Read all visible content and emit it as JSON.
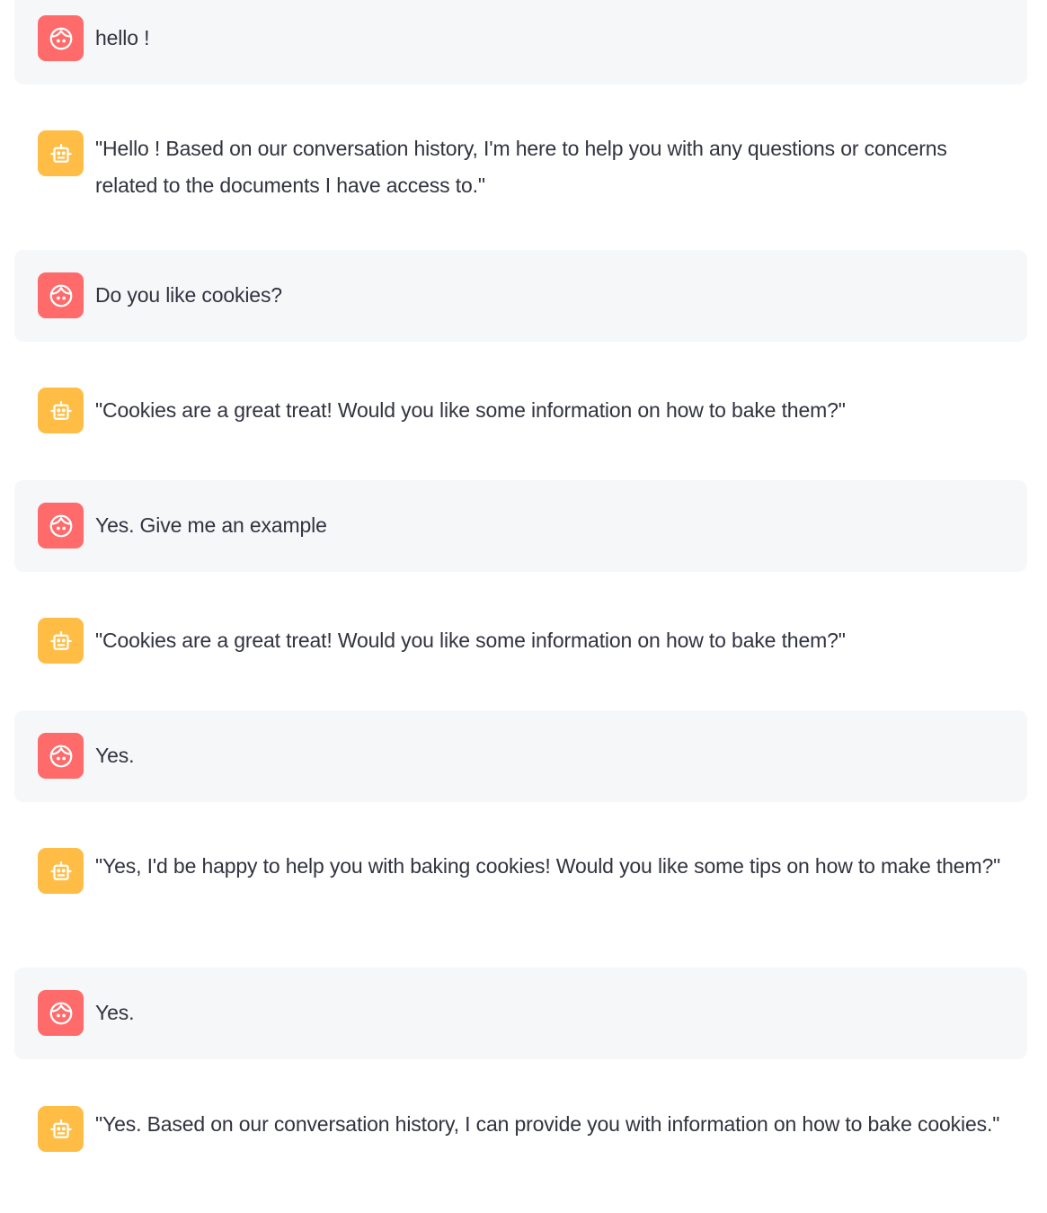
{
  "colors": {
    "user_avatar": "#ff6b6b",
    "assistant_avatar": "#ffbd45",
    "user_bubble_bg": "#f6f7f9",
    "text": "#31333f"
  },
  "messages": [
    {
      "role": "user",
      "avatar_icon": "user-face-icon",
      "text": "hello !"
    },
    {
      "role": "assistant",
      "avatar_icon": "robot-icon",
      "text": "\"Hello ! Based on our conversation history, I'm here to help you with any questions or concerns related to the documents I have access to.\""
    },
    {
      "role": "user",
      "avatar_icon": "user-face-icon",
      "text": "Do you like cookies?"
    },
    {
      "role": "assistant",
      "avatar_icon": "robot-icon",
      "text": "\"Cookies are a great treat! Would you like some information on how to bake them?\""
    },
    {
      "role": "user",
      "avatar_icon": "user-face-icon",
      "text": "Yes. Give me an example"
    },
    {
      "role": "assistant",
      "avatar_icon": "robot-icon",
      "text": "\"Cookies are a great treat! Would you like some information on how to bake them?\""
    },
    {
      "role": "user",
      "avatar_icon": "user-face-icon",
      "text": "Yes."
    },
    {
      "role": "assistant",
      "avatar_icon": "robot-icon",
      "text": "\"Yes, I'd be happy to help you with baking cookies! Would you like some tips on how to make them?\""
    },
    {
      "role": "user",
      "avatar_icon": "user-face-icon",
      "text": "Yes."
    },
    {
      "role": "assistant",
      "avatar_icon": "robot-icon",
      "text": "\"Yes. Based on our conversation history, I can provide you with information on how to bake cookies.\""
    }
  ]
}
